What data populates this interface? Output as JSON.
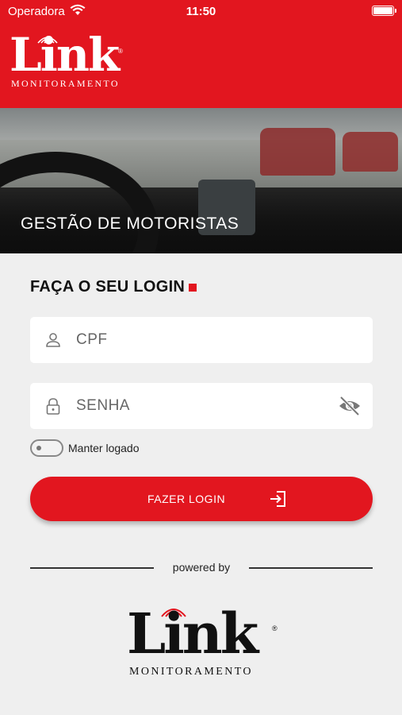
{
  "status_bar": {
    "carrier": "Operadora",
    "time": "11:50"
  },
  "brand": {
    "name": "Link",
    "subtitle": "MONITORAMENTO",
    "registered": "®"
  },
  "banner": {
    "title": "GESTÃO DE MOTORISTAS"
  },
  "login": {
    "title": "FAÇA O SEU LOGIN",
    "cpf_placeholder": "CPF",
    "password_placeholder": "SENHA",
    "keep_logged": "Manter logado",
    "button_label": "FAZER LOGIN"
  },
  "footer": {
    "powered_by": "powered by"
  },
  "colors": {
    "brand_red": "#e2161f",
    "background": "#efefef"
  },
  "icons": [
    "wifi-icon",
    "battery-icon",
    "user-icon",
    "lock-icon",
    "eye-slash-icon",
    "login-enter-icon"
  ]
}
